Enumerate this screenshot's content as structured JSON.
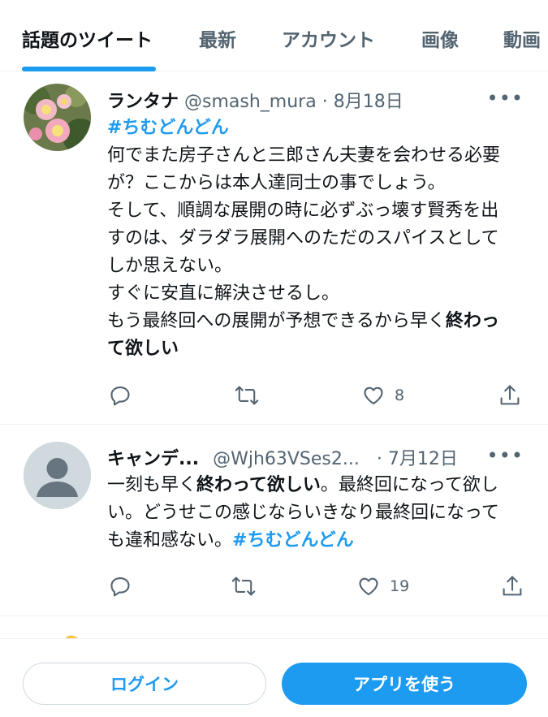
{
  "tabs": [
    {
      "label": "話題のツイート",
      "active": true
    },
    {
      "label": "最新"
    },
    {
      "label": "アカウント"
    },
    {
      "label": "画像"
    },
    {
      "label": "動画"
    }
  ],
  "tweets": [
    {
      "name": "ランタナ",
      "handle": "@smash_mura",
      "sep": "·",
      "date": "8月18日",
      "hashtag": "#ちむどんどん",
      "text_plain": "何でまた房子さんと三郎さん夫妻を会わせる必要が？ここからは本人達同士の事でしょう。\nそして、順調な展開の時に必ずぶっ壊す賢秀を出すのは、ダラダラ展開へのただのスパイスとしてしか思えない。\nすぐに安直に解決させるし。\nもう最終回への展開が予想できるから早く",
      "text_bold": "終わって欲しい",
      "likes": "8"
    },
    {
      "name": "キャンデ...",
      "handle": "@Wjh63VSes2...",
      "sep": "·",
      "date": "7月12日",
      "text_pre": "一刻も早く",
      "text_bold": "終わって欲しい",
      "text_post": "。最終回になって欲しい。どうせこの感じならいきなり最終回になっても違和感ない。",
      "hashtag": "#ちむどんどん",
      "likes": "19"
    }
  ],
  "more_label": "•••",
  "bottom_bar": {
    "login_label": "ログイン",
    "app_label": "アプリを使う"
  },
  "colors": {
    "accent": "#1d9bf0",
    "text": "#0f1419",
    "muted": "#536471",
    "border": "#eff3f4"
  },
  "icons": [
    "reply-icon",
    "retweet-icon",
    "like-icon",
    "share-icon",
    "more-icon"
  ]
}
